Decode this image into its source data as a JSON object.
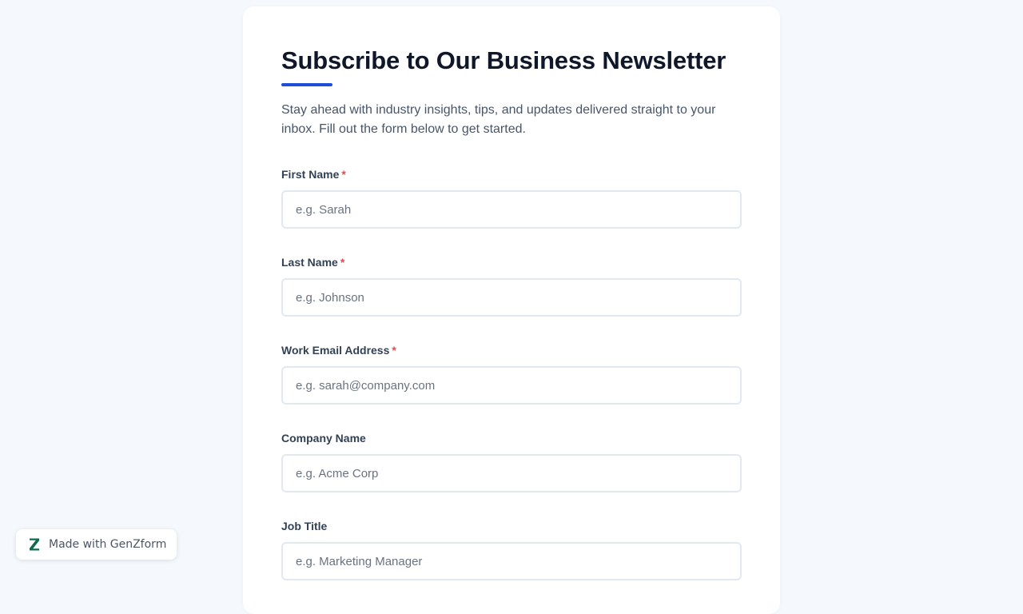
{
  "form": {
    "title": "Subscribe to Our Business Newsletter",
    "description": "Stay ahead with industry insights, tips, and updates delivered straight to your inbox. Fill out the form below to get started.",
    "required_marker": "*",
    "fields": [
      {
        "label": "First Name",
        "placeholder": "e.g. Sarah",
        "value": "",
        "required": true
      },
      {
        "label": "Last Name",
        "placeholder": "e.g. Johnson",
        "value": "",
        "required": true
      },
      {
        "label": "Work Email Address",
        "placeholder": "e.g. sarah@company.com",
        "value": "",
        "required": true
      },
      {
        "label": "Company Name",
        "placeholder": "e.g. Acme Corp",
        "value": "",
        "required": false
      },
      {
        "label": "Job Title",
        "placeholder": "e.g. Marketing Manager",
        "value": "",
        "required": false
      }
    ]
  },
  "badge": {
    "text": "Made with GenZform",
    "icon": "genzform-z-logo-icon"
  },
  "colors": {
    "accent": "#1d4ed8",
    "required": "#ef4444",
    "page_background": "#f5f8fc",
    "brand_logo": "#0f6b4f"
  }
}
